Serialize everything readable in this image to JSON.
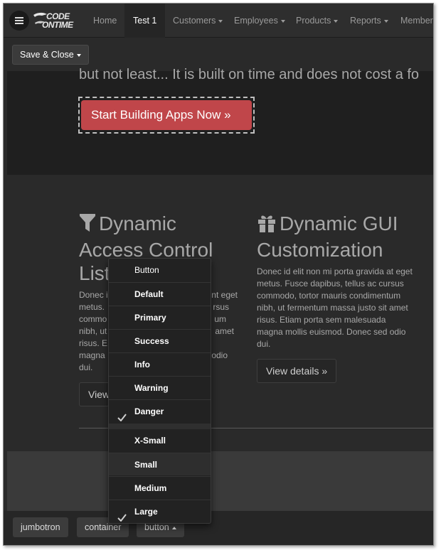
{
  "navbar": {
    "logo_line1": "CODE",
    "logo_line2": "ONTIME",
    "items": [
      {
        "label": "Home"
      },
      {
        "label": "Test 1"
      },
      {
        "label": "Customers"
      },
      {
        "label": "Employees"
      },
      {
        "label": "Products"
      },
      {
        "label": "Reports"
      },
      {
        "label": "Member"
      }
    ],
    "active_item": "Test 1"
  },
  "toolbar": {
    "save_close_label": "Save & Close"
  },
  "jumbotron": {
    "text": "but not least... It is built on time and does not cost a fo",
    "cta_label": "Start Building Apps Now »",
    "cta_color": "#c0464a"
  },
  "columns": [
    {
      "icon": "filter-icon",
      "title_lines": [
        "Dynamic",
        "Access Control",
        "List"
      ],
      "text_lines": [
        "Donec i",
        "metus. ",
        "commo",
        "nibh, ut",
        "risus. E",
        "magna",
        "dui."
      ],
      "text_tail": [
        "nt eget",
        "rsus",
        "um",
        "amet",
        "",
        "odio",
        ""
      ],
      "button_label": "View"
    },
    {
      "icon": "gift-icon",
      "title_lines": [
        "Dynamic GUI",
        "Customization"
      ],
      "text_lines": [
        "Donec id elit non mi porta gravida at eget",
        "metus. Fusce dapibus, tellus ac cursus",
        "commodo, tortor mauris condimentum",
        "nibh, ut fermentum massa justo sit amet",
        "risus. Etiam porta sem malesuada",
        "magna mollis euismod. Donec sed odio",
        "dui."
      ],
      "button_label": "View details »"
    }
  ],
  "dropdown": {
    "header": "Button",
    "group1": [
      {
        "label": "Default",
        "checked": false
      },
      {
        "label": "Primary",
        "checked": false
      },
      {
        "label": "Success",
        "checked": false
      },
      {
        "label": "Info",
        "checked": false
      },
      {
        "label": "Warning",
        "checked": false
      },
      {
        "label": "Danger",
        "checked": true
      }
    ],
    "group2": [
      {
        "label": "X-Small",
        "checked": false
      },
      {
        "label": "Small",
        "checked": false
      },
      {
        "label": "Medium",
        "checked": false
      },
      {
        "label": "Large",
        "checked": true
      }
    ]
  },
  "breadcrumbs": [
    {
      "label": "jumbotron"
    },
    {
      "label": "container"
    },
    {
      "label": "button"
    }
  ]
}
